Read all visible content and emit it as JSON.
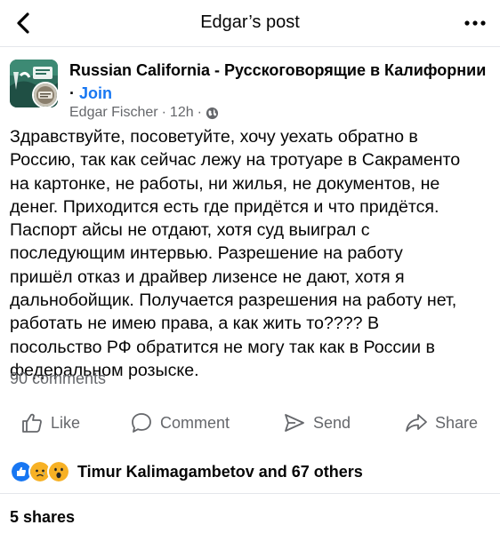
{
  "header": {
    "title": "Edgar’s post",
    "back_icon": "chevron-left-icon",
    "more_icon": "more-horizontal-icon"
  },
  "post": {
    "group_name": "Russian California - Русскоговорящие в Калифорнии",
    "separator": "·",
    "join_label": "Join",
    "author": "Edgar Fischer",
    "time": "12h",
    "privacy_icon": "globe-icon",
    "text_lines": [
      "Здравствуйте, посоветуйте, хочу уехать обратно в",
      "Россию, так как сейчас лежу на тротуаре в Сакраменто",
      "на картонке, не работы, ни жилья, не документов, не",
      "денег. Приходится есть где придётся и что придётся.",
      "Паспорт айсы не отдают, хотя суд выиграл с",
      "последующим интервью. Разрешение на работу",
      "пришёл отказ и драйвер лизенсе не дают, хотя я",
      "дальнобойщик. Получается разрешения на работу нет,",
      "работать не имею права, а как жить то???? В",
      "посольство РФ обратится не могу так как в России в",
      "федеральном розыске."
    ]
  },
  "stats": {
    "comments": "90 comments",
    "reactions_text": "Timur Kalimagambetov and 67 others",
    "shares": "5 shares"
  },
  "actions": {
    "like": "Like",
    "comment": "Comment",
    "send": "Send",
    "share": "Share"
  },
  "colors": {
    "link": "#1877f2",
    "secondary_text": "#65676b",
    "like_blue": "#1877f2",
    "reaction_yellow": "#f7b125"
  }
}
